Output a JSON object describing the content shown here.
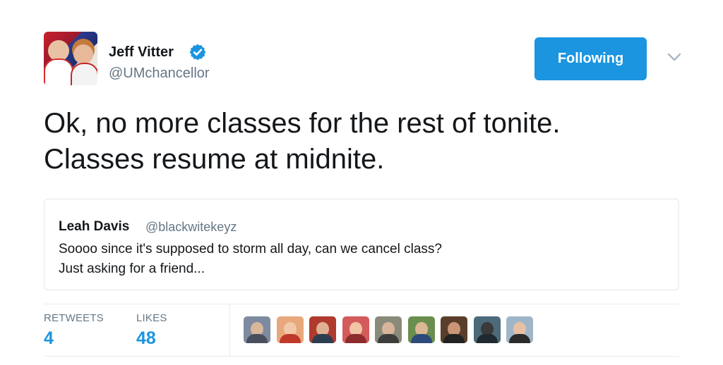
{
  "author": {
    "name": "Jeff Vitter",
    "handle": "@UMchancellor",
    "verified": true
  },
  "follow_button": {
    "label": "Following"
  },
  "tweet": {
    "lines": [
      "Ok, no more classes for the rest of tonite.",
      "Classes resume at midnite."
    ]
  },
  "quoted_tweet": {
    "name": "Leah Davis",
    "handle": "@blackwitekeyz",
    "lines": [
      "Soooo since it's supposed to storm all day, can we cancel class?",
      "Just asking for a friend..."
    ]
  },
  "stats": {
    "retweets": {
      "label": "RETWEETS",
      "value": "4"
    },
    "likes": {
      "label": "LIKES",
      "value": "48"
    }
  },
  "colors": {
    "accent": "#1b95e0",
    "text": "#14171a",
    "muted": "#657786",
    "border": "#e1e8ed"
  },
  "icons": [
    "verified-badge-icon",
    "chevron-down-icon"
  ],
  "liker_count": 9
}
